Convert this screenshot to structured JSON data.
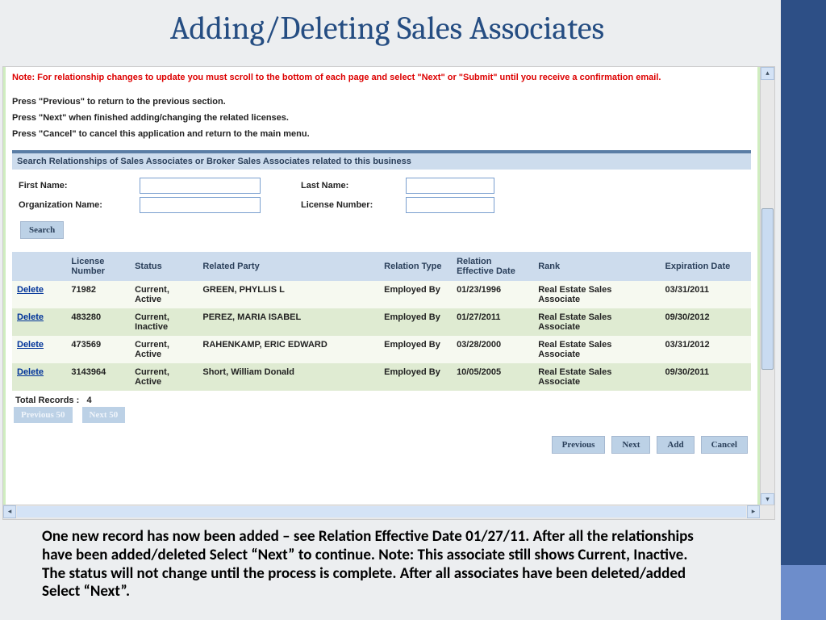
{
  "title": "Adding/Deleting Sales Associates",
  "note": "Note: For relationship changes to update you must scroll to the bottom of each page and select \"Next\" or \"Submit\" until you receive a confirmation email.",
  "instructions": [
    "Press \"Previous\" to return to the previous section.",
    "Press \"Next\" when finished adding/changing the related licenses.",
    "Press \"Cancel\" to cancel this application and return to the main menu."
  ],
  "search": {
    "header": "Search Relationships of Sales Associates or Broker Sales Associates related to this business",
    "labels": {
      "first": "First Name:",
      "last": "Last Name:",
      "org": "Organization Name:",
      "license": "License Number:"
    },
    "button": "Search"
  },
  "table": {
    "headers": {
      "action": "",
      "license": "License Number",
      "status": "Status",
      "party": "Related Party",
      "reltype": "Relation Type",
      "effdate": "Relation Effective Date",
      "rank": "Rank",
      "expdate": "Expiration Date"
    },
    "rows": [
      {
        "action": "Delete",
        "license": "71982",
        "status": "Current, Active",
        "party": "GREEN, PHYLLIS L",
        "reltype": "Employed By",
        "effdate": "01/23/1996",
        "rank": "Real Estate Sales Associate",
        "expdate": "03/31/2011"
      },
      {
        "action": "Delete",
        "license": "483280",
        "status": "Current, Inactive",
        "party": "PEREZ, MARIA ISABEL",
        "reltype": "Employed By",
        "effdate": "01/27/2011",
        "rank": "Real Estate Sales Associate",
        "expdate": "09/30/2012"
      },
      {
        "action": "Delete",
        "license": "473569",
        "status": "Current, Active",
        "party": "RAHENKAMP, ERIC EDWARD",
        "reltype": "Employed By",
        "effdate": "03/28/2000",
        "rank": "Real Estate Sales Associate",
        "expdate": "03/31/2012"
      },
      {
        "action": "Delete",
        "license": "3143964",
        "status": "Current, Active",
        "party": "Short, William Donald",
        "reltype": "Employed By",
        "effdate": "10/05/2005",
        "rank": "Real Estate Sales Associate",
        "expdate": "09/30/2011"
      }
    ],
    "totals_label": "Total Records :",
    "totals_value": "4",
    "prev50": "Previous 50",
    "next50": "Next 50"
  },
  "actions": {
    "previous": "Previous",
    "next": "Next",
    "add": "Add",
    "cancel": "Cancel"
  },
  "caption": "One new record has now been added – see Relation Effective Date 01/27/11. After all the relationships have been added/deleted Select “Next” to continue. Note: This associate still shows Current, Inactive. The status will not change until the process is complete. After all associates have been deleted/added Select “Next”."
}
